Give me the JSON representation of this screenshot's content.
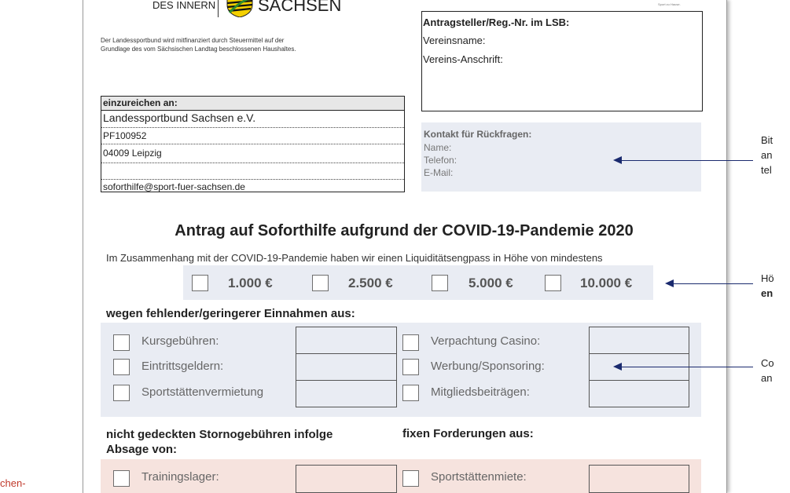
{
  "header": {
    "ministry": "DES INNERN",
    "state": "SACHSEN",
    "funding_note_1": "Der Landessportbund wird mitfinanziert durch Steuermittel auf der",
    "funding_note_2": "Grundlage des vom Sächsischen Landtag beschlossenen Haushaltes.",
    "logo_tag": "Sport zu Hause."
  },
  "applicant": {
    "title": "Antragsteller/Reg.-Nr. im LSB:",
    "name_label": "Vereinsname:",
    "address_label": "Vereins-Anschrift:"
  },
  "submit_to": {
    "title": "einzureichen an:",
    "org": "Landessportbund Sachsen e.V.",
    "po_box": "PF100952",
    "city": "04009 Leipzig",
    "email": "soforthilfe@sport-fuer-sachsen.de"
  },
  "contact": {
    "title": "Kontakt für Rückfragen:",
    "name": "Name:",
    "phone": "Telefon:",
    "email": "E-Mail:"
  },
  "form": {
    "title": "Antrag auf Soforthilfe aufgrund der COVID-19-Pandemie 2020",
    "intro": "Im Zusammenhang mit der COVID-19-Pandemie haben wir einen Liquiditätsengpass in Höhe von mindestens",
    "amounts": [
      "1.000 €",
      "2.500 €",
      "5.000 €",
      "10.000 €"
    ],
    "income_heading": "wegen fehlender/geringerer Einnahmen aus:",
    "income_left": [
      "Kursgebühren:",
      "Eintrittsgeldern:",
      "Sportstättenvermietung"
    ],
    "income_right": [
      "Verpachtung Casino:",
      "Werbung/Sponsoring:",
      "Mitgliedsbeiträgen:"
    ],
    "storno_heading_1": "nicht gedeckten Stornogebühren infolge",
    "storno_heading_2": "Absage von:",
    "fixed_heading": "fixen Forderungen aus:",
    "storno_item": "Trainingslager:",
    "fixed_item": "Sportstättenmiete:"
  },
  "side_notes": {
    "note1": [
      "Bit",
      "an",
      "tel"
    ],
    "note2_line1": "Hö",
    "note2_line2": "en",
    "note3": [
      "Co",
      "an"
    ],
    "left_note": "chen-"
  },
  "colors": {
    "grey_panel": "#e9ecf3",
    "pink_panel": "#f6e3de",
    "arrow": "#1a2a6e",
    "left_note": "#c0392b"
  }
}
